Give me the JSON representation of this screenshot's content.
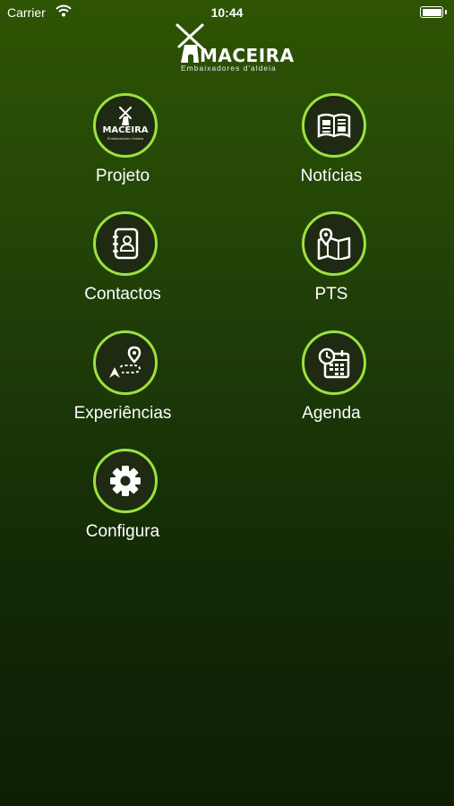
{
  "status_bar": {
    "carrier": "Carrier",
    "time": "10:44"
  },
  "header": {
    "logo_text": "MACEIRA",
    "logo_subtitle": "Embaixadores d'aldeia"
  },
  "menu": {
    "items": [
      {
        "label": "Projeto",
        "icon": "maceira-logo-icon",
        "logo_text": "MACEIRA",
        "logo_subtitle": "Embaixadores d'aldeia"
      },
      {
        "label": "Notícias",
        "icon": "newspaper-icon"
      },
      {
        "label": "Contactos",
        "icon": "address-book-icon"
      },
      {
        "label": "PTS",
        "icon": "map-pin-icon"
      },
      {
        "label": "Experiências",
        "icon": "route-icon"
      },
      {
        "label": "Agenda",
        "icon": "calendar-icon"
      },
      {
        "label": "Configura",
        "icon": "gear-icon"
      }
    ]
  },
  "colors": {
    "accent": "#9be23c",
    "circle_fill": "#1e2a12",
    "background_top": "#2e5404",
    "background_bottom": "#0d1e04"
  }
}
